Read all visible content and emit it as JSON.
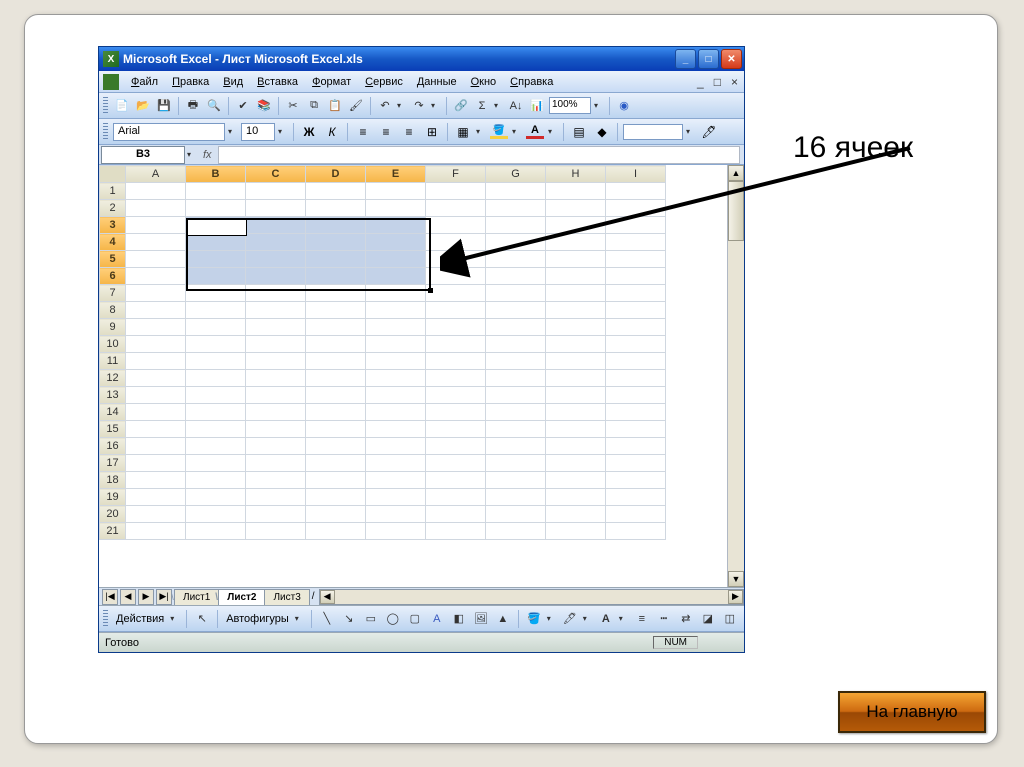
{
  "title": "Microsoft Excel - Лист Microsoft Excel.xls",
  "menus": [
    "Файл",
    "Правка",
    "Вид",
    "Вставка",
    "Формат",
    "Сервис",
    "Данные",
    "Окно",
    "Справка"
  ],
  "zoom": "100%",
  "font": {
    "name": "Arial",
    "size": "10"
  },
  "bold_label": "Ж",
  "italic_label": "К",
  "name_box": "B3",
  "fx": "fx",
  "columns": [
    "A",
    "B",
    "C",
    "D",
    "E",
    "F",
    "G",
    "H",
    "I"
  ],
  "rows": 21,
  "sel_cols": [
    "B",
    "C",
    "D",
    "E"
  ],
  "sel_rows": [
    3,
    4,
    5,
    6
  ],
  "sheet_nav": [
    "|◀",
    "◀",
    "▶",
    "▶|"
  ],
  "sheets": [
    "Лист1",
    "Лист2",
    "Лист3"
  ],
  "active_sheet": 1,
  "draw_action": "Действия",
  "autoshapes": "Автофигуры",
  "status_ready": "Готово",
  "status_num": "NUM",
  "annotation": "16 ячеек",
  "home_btn": "На главную"
}
